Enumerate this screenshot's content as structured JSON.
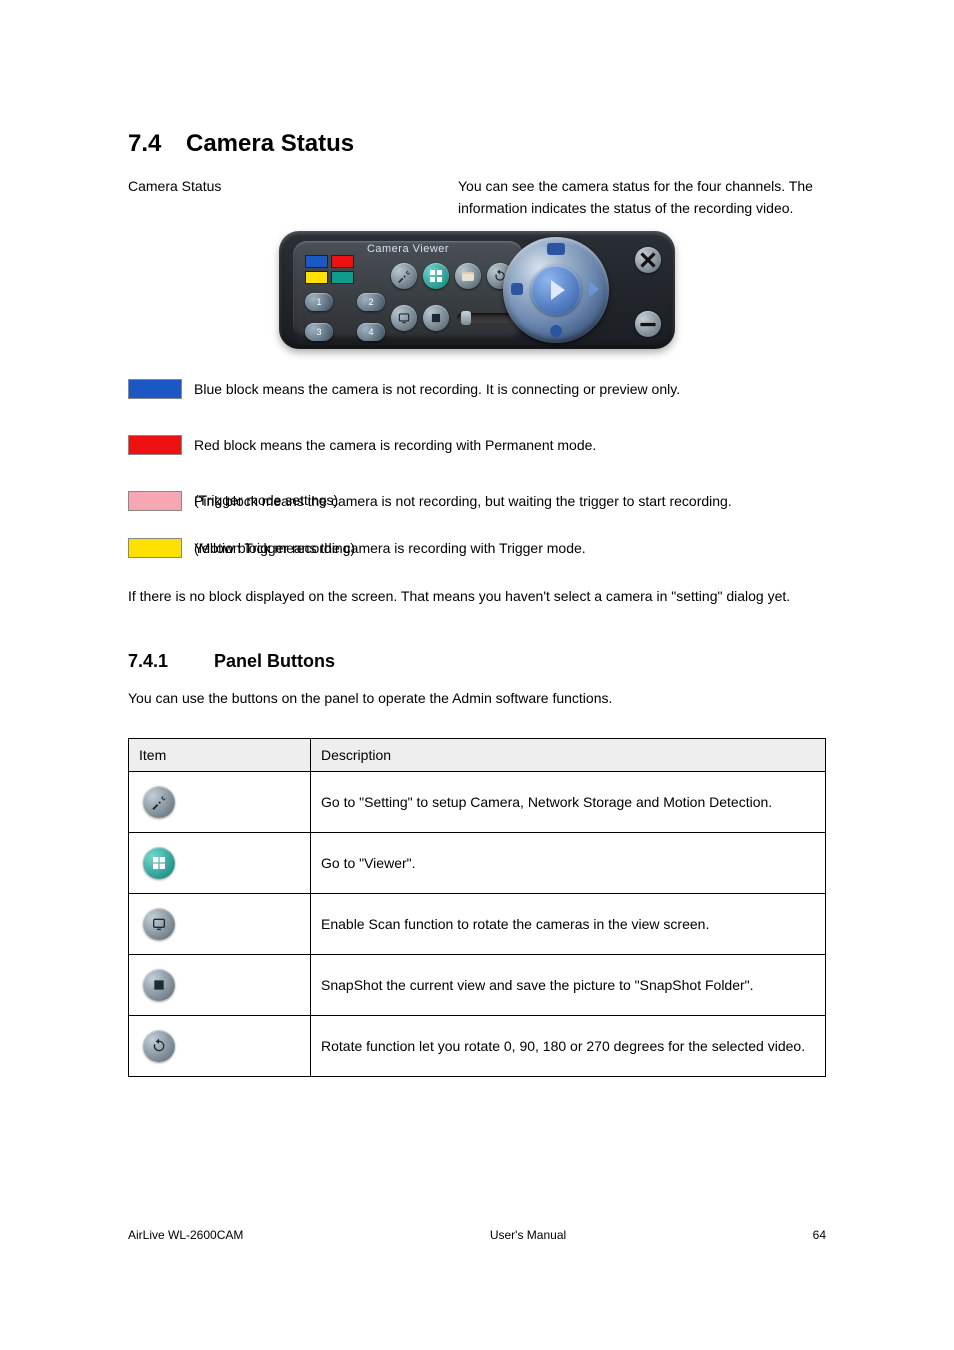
{
  "section": {
    "number": "7.4",
    "title": "Camera Status"
  },
  "intro": {
    "left": "Camera Status",
    "right": "You can see the camera status for the four channels. The information indicates the status of the recording video."
  },
  "panel": {
    "title": "Camera Viewer",
    "channels": [
      "1",
      "2",
      "3",
      "4"
    ]
  },
  "defs": [
    {
      "color": "blue",
      "text": "Blue block means the camera is not recording. It is connecting or preview only."
    },
    {
      "color": "red",
      "text": "Red block means the camera is recording with Permanent mode."
    },
    {
      "color": "pink",
      "text": "Pink block means the camera is not recording, but waiting the trigger to start recording."
    },
    {
      "color": "yellow",
      "text": "Yellow block means the camera is recording with Trigger mode."
    }
  ],
  "pink_note": "(Trigger mode settings)",
  "yellow_note": "(Motion Trigger recording)",
  "no_block": "If there is no block displayed on the screen. That means you haven't select a camera in \"setting\" dialog yet.",
  "subsection": {
    "number": "7.4.1",
    "title": "Panel Buttons",
    "desc": "You can use the buttons on the panel to operate the Admin software functions."
  },
  "table": {
    "headers": [
      "Item",
      "Description"
    ],
    "rows": [
      {
        "name": "setting-icon",
        "type": "wrench",
        "teal": false,
        "desc": "Go to \"Setting\" to setup Camera, Network Storage and Motion Detection."
      },
      {
        "name": "view-icon",
        "type": "grid4",
        "teal": true,
        "desc": "Go to \"Viewer\"."
      },
      {
        "name": "scan-icon",
        "type": "tv",
        "teal": false,
        "desc": "Enable Scan function to rotate the cameras in the view screen."
      },
      {
        "name": "snapshot-icon",
        "type": "arrow",
        "teal": false,
        "desc": "SnapShot the current view and save the picture to \"SnapShot Folder\"."
      },
      {
        "name": "rotate-icon",
        "type": "circ",
        "teal": false,
        "desc": "Rotate function let you rotate 0, 90, 180 or 270 degrees for the selected video."
      }
    ]
  },
  "footer": {
    "left": "AirLive WL-2600CAM",
    "center": "User's Manual",
    "page": "64"
  }
}
